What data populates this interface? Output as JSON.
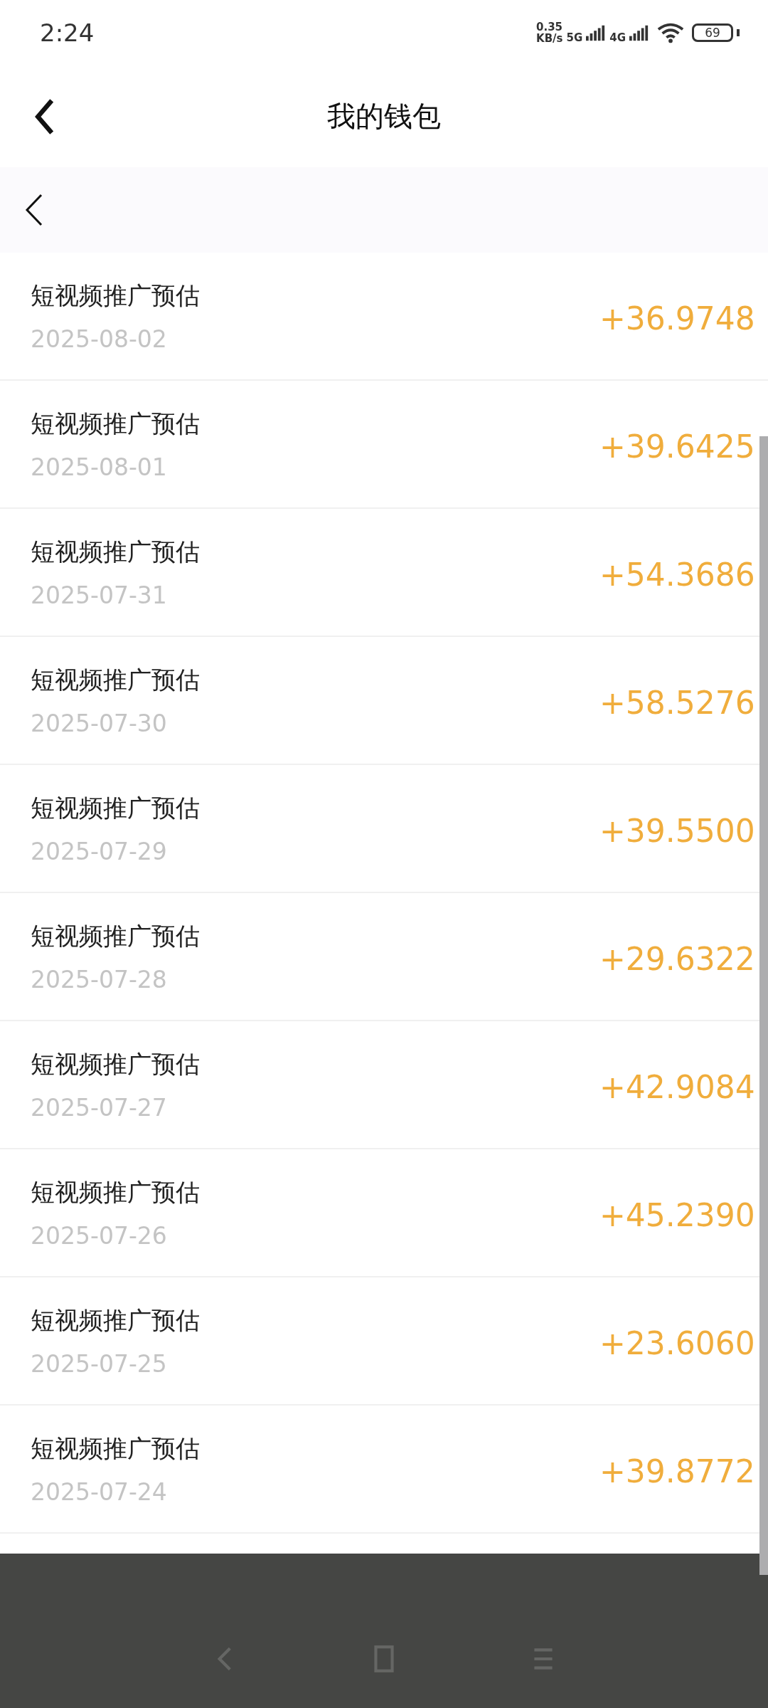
{
  "status_bar": {
    "time": "2:24",
    "speed_value": "0.35",
    "speed_unit": "KB/s",
    "network_1": "5G",
    "network_2": "4G",
    "battery": "69"
  },
  "header": {
    "title": "我的钱包"
  },
  "records": [
    {
      "title": "短视频推广预估",
      "date": "2025-08-02",
      "amount": "+36.9748"
    },
    {
      "title": "短视频推广预估",
      "date": "2025-08-01",
      "amount": "+39.6425"
    },
    {
      "title": "短视频推广预估",
      "date": "2025-07-31",
      "amount": "+54.3686"
    },
    {
      "title": "短视频推广预估",
      "date": "2025-07-30",
      "amount": "+58.5276"
    },
    {
      "title": "短视频推广预估",
      "date": "2025-07-29",
      "amount": "+39.5500"
    },
    {
      "title": "短视频推广预估",
      "date": "2025-07-28",
      "amount": "+29.6322"
    },
    {
      "title": "短视频推广预估",
      "date": "2025-07-27",
      "amount": "+42.9084"
    },
    {
      "title": "短视频推广预估",
      "date": "2025-07-26",
      "amount": "+45.2390"
    },
    {
      "title": "短视频推广预估",
      "date": "2025-07-25",
      "amount": "+23.6060"
    },
    {
      "title": "短视频推广预估",
      "date": "2025-07-24",
      "amount": "+39.8772"
    }
  ]
}
